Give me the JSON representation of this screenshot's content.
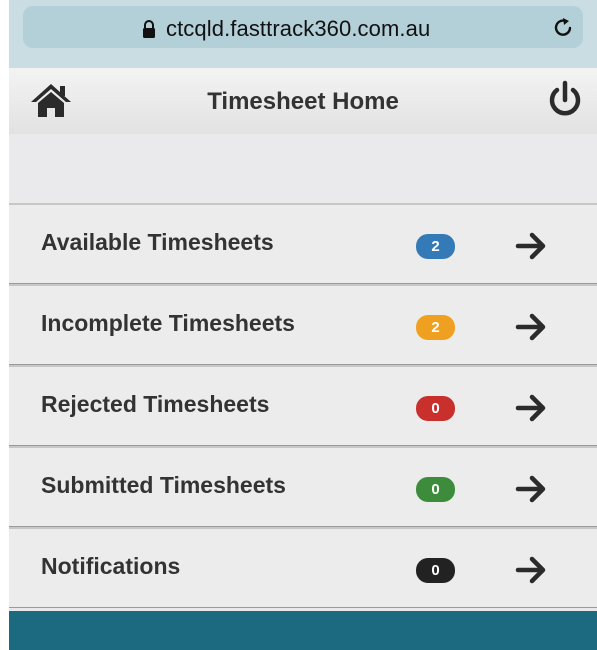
{
  "browser": {
    "url": "ctcqld.fasttrack360.com.au",
    "lock_icon": "lock-icon",
    "reload_icon": "reload-icon"
  },
  "header": {
    "title": "Timesheet Home",
    "home_icon": "home-icon",
    "power_icon": "power-icon"
  },
  "menu": {
    "items": [
      {
        "label": "Available Timesheets",
        "count": "2",
        "badge_color": "#337ab7"
      },
      {
        "label": "Incomplete Timesheets",
        "count": "2",
        "badge_color": "#f0a020"
      },
      {
        "label": "Rejected Timesheets",
        "count": "0",
        "badge_color": "#c9302c"
      },
      {
        "label": "Submitted Timesheets",
        "count": "0",
        "badge_color": "#3c8c3c"
      },
      {
        "label": "Notifications",
        "count": "0",
        "badge_color": "#222222"
      }
    ],
    "arrow_icon": "arrow-right-icon"
  },
  "colors": {
    "footer": "#1c6a80",
    "background": "#e9e9eb"
  }
}
